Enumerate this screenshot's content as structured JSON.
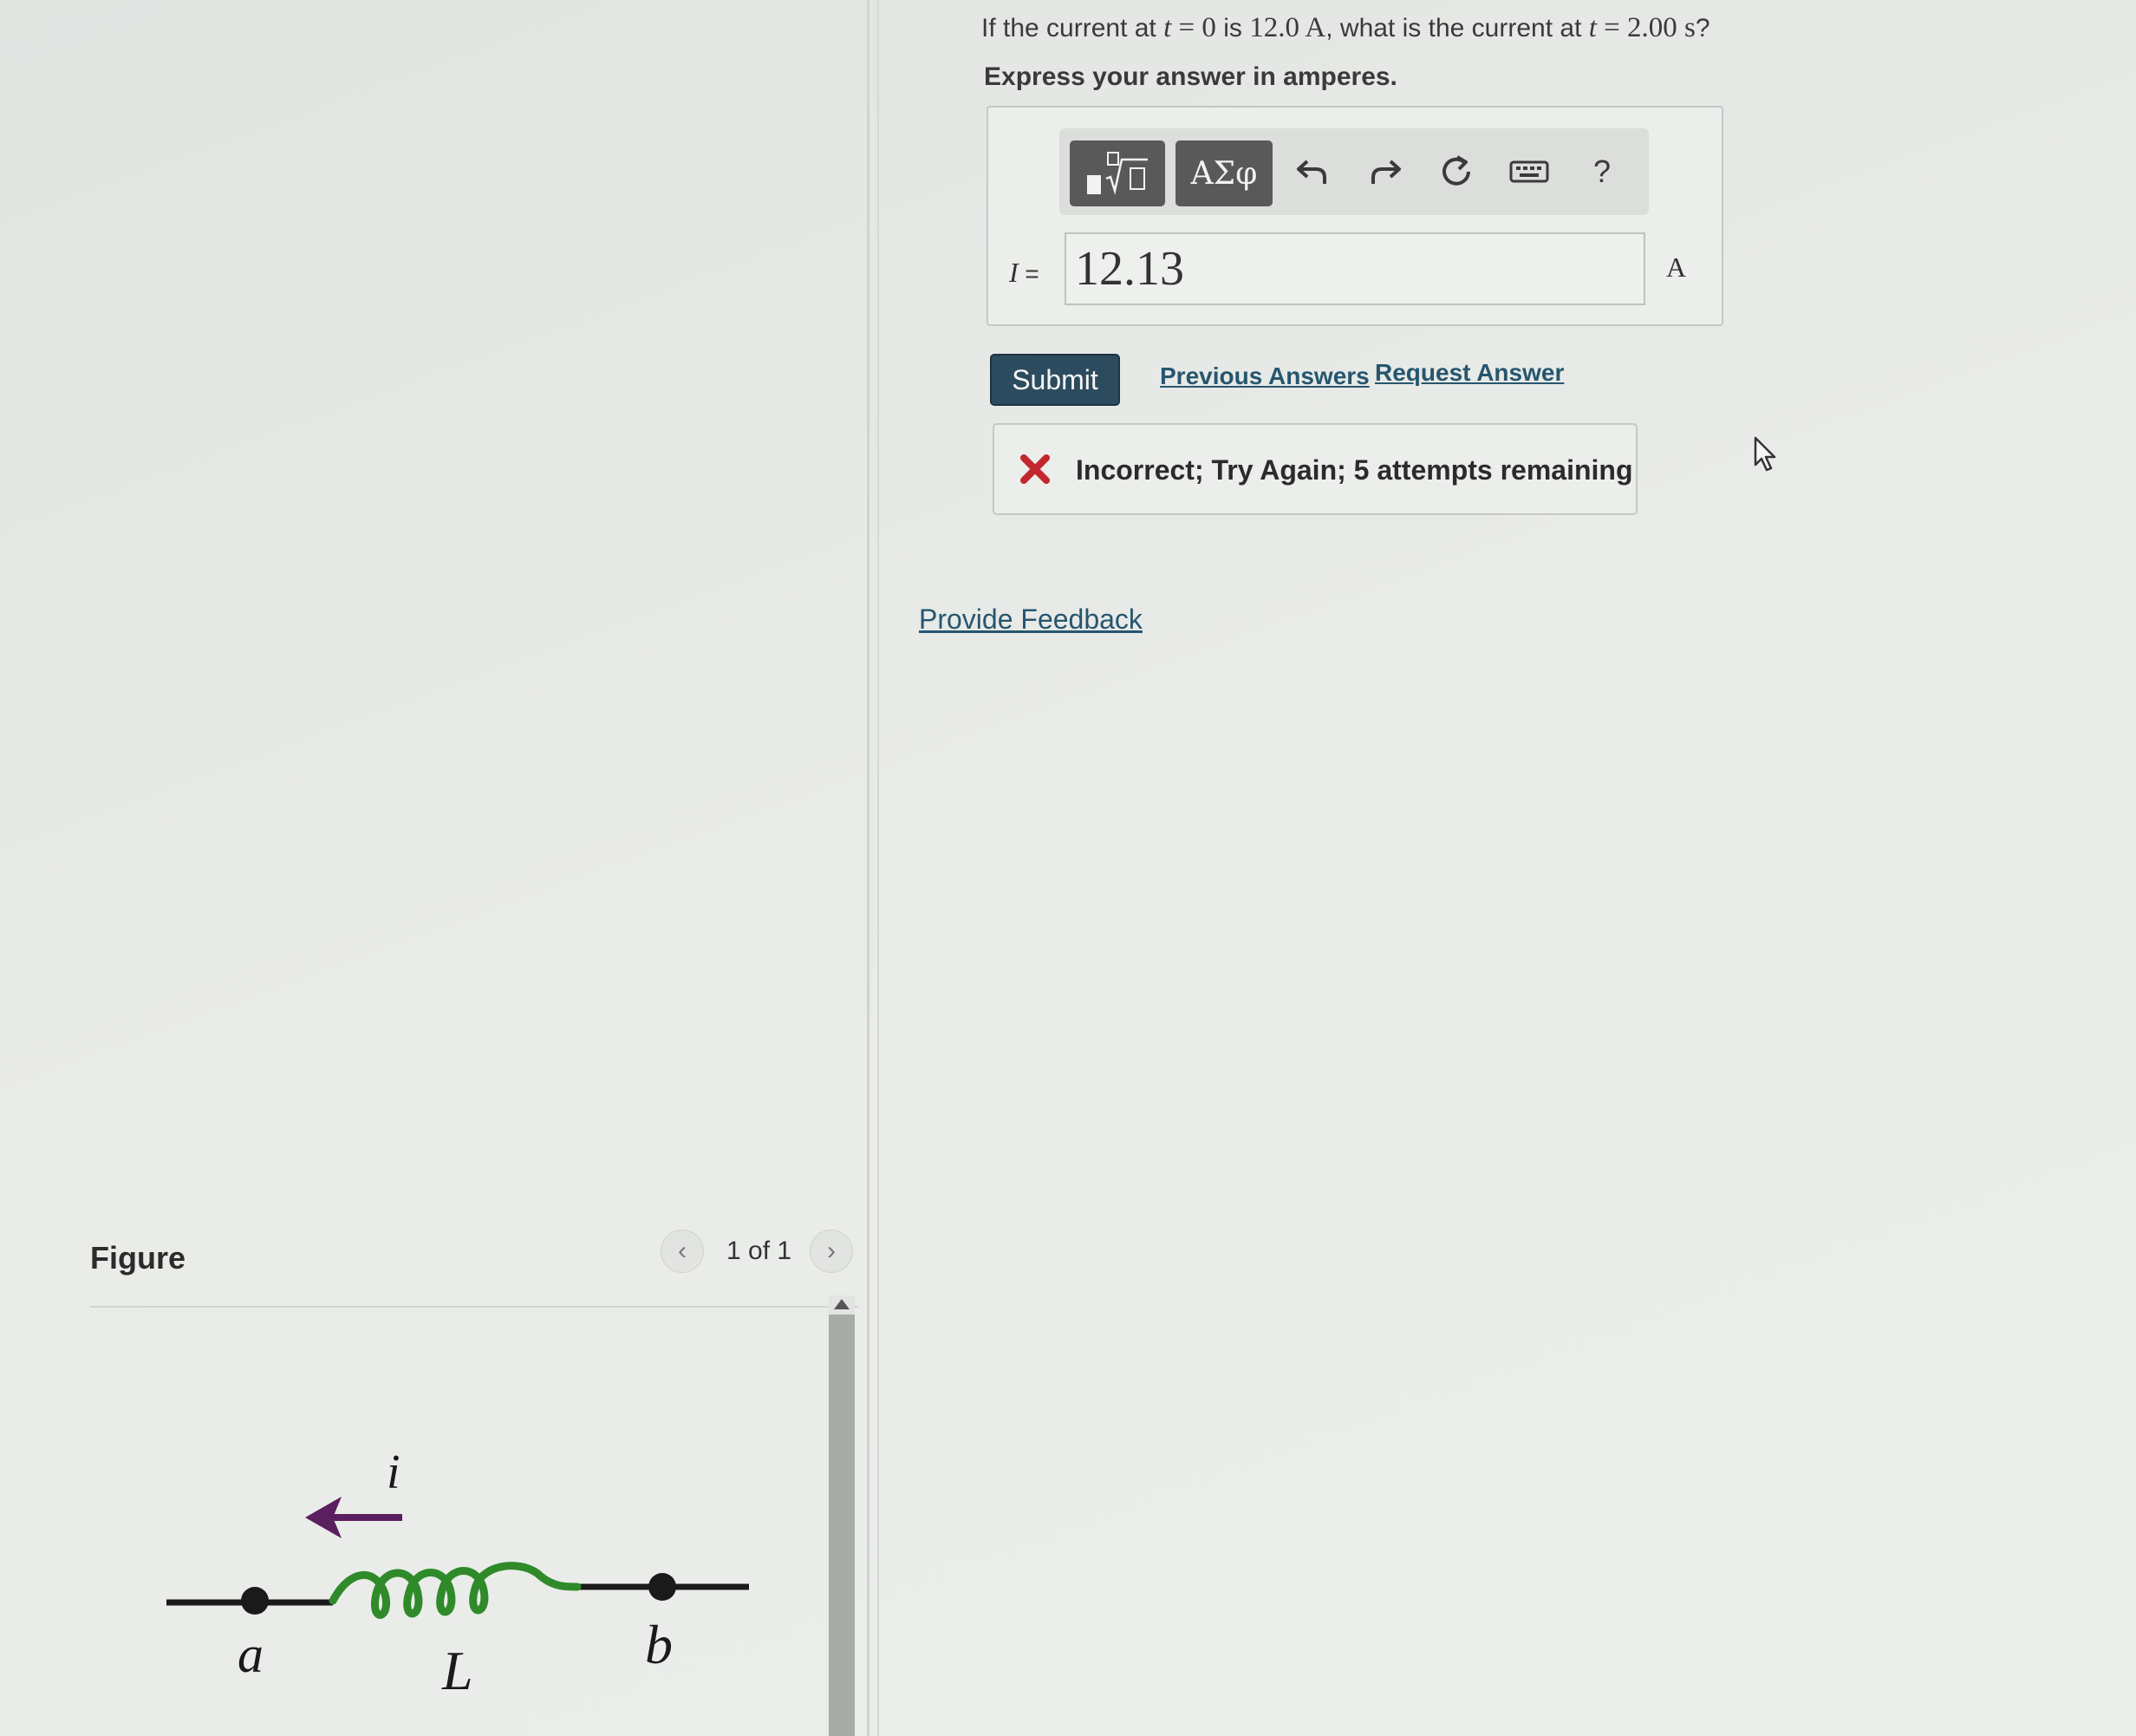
{
  "question": {
    "part1": "If the current at ",
    "t1": "t",
    "eq1": " = 0",
    "part2": " is ",
    "value1": "12.0 A",
    "part3": ", what is the current at ",
    "t2": "t",
    "eq2": " = 2.00 s",
    "part4": "?"
  },
  "instruction": "Express your answer in amperes.",
  "toolbar": {
    "symbols_label": "ΑΣφ",
    "help_label": "?"
  },
  "answer": {
    "variable": "I",
    "equals": " =",
    "value": "12.13",
    "unit": "A"
  },
  "actions": {
    "submit_label": "Submit",
    "previous_answers": "Previous Answers",
    "request_answer": "Request Answer"
  },
  "feedback": {
    "message": "Incorrect; Try Again; 5 attempts remaining"
  },
  "provide_feedback": "Provide Feedback",
  "figure": {
    "title": "Figure",
    "pager": "1 of 1",
    "label_current": "i",
    "label_a": "a",
    "label_inductor": "L",
    "label_b": "b",
    "coil_color": "#2f8a2a",
    "arrow_color": "#5a1f5e"
  }
}
